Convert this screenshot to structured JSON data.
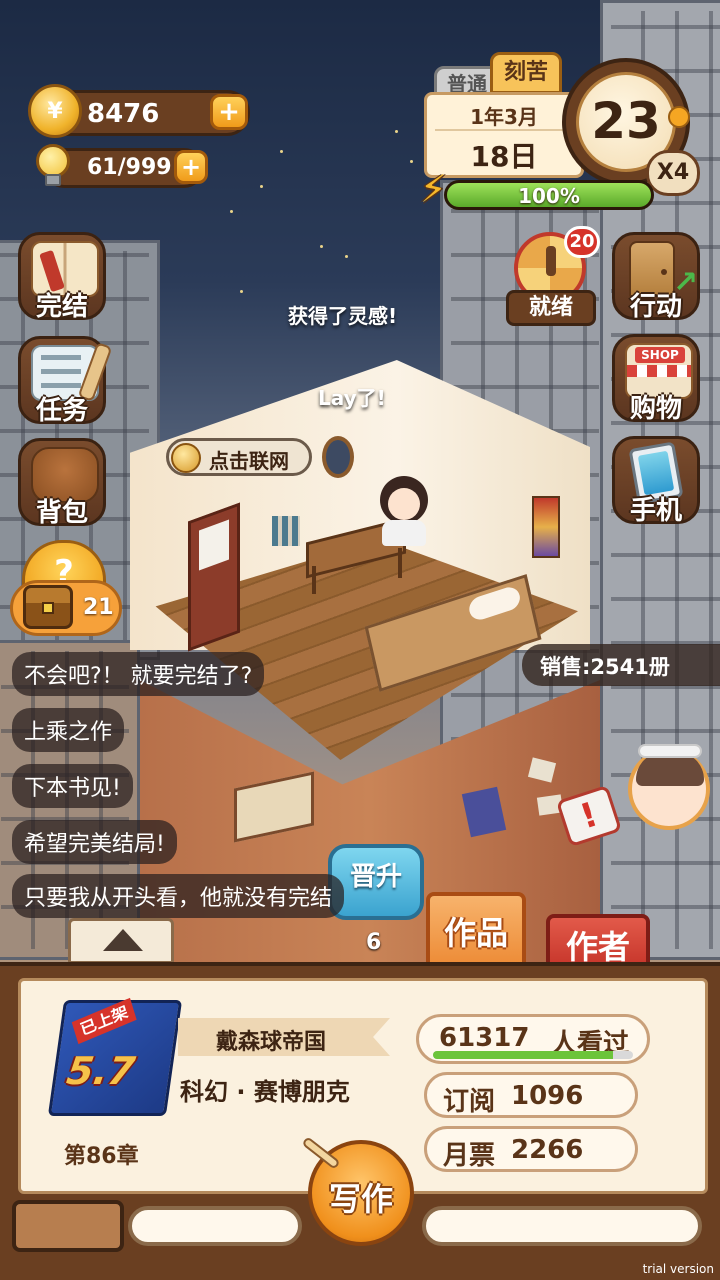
{
  "currency": {
    "coins": "8476",
    "inspiration": "61/999",
    "plus": "+"
  },
  "calendar": {
    "mode_normal": "普通",
    "mode_hard": "刻苦",
    "year_month": "1年3月",
    "day": "18日",
    "timer": "23",
    "speed": "X4",
    "energy_percent": "100%",
    "energy_fraction": 1.0
  },
  "left_menu": [
    {
      "label": "完结"
    },
    {
      "label": "任务"
    },
    {
      "label": "背包"
    }
  ],
  "treasure": {
    "count": "21"
  },
  "right_menu": {
    "ready": {
      "label": "就绪",
      "badge": "20"
    },
    "action": {
      "label": "行动"
    },
    "shop": {
      "label": "购物",
      "sign": "SHOP"
    },
    "phone": {
      "label": "手机"
    }
  },
  "room": {
    "float_text_1": "获得了灵感!",
    "float_text_2": "Lay了!",
    "connect_label": "点击联网",
    "sales": "销售:2541册",
    "promote_label": "晋升",
    "promote_count": "6"
  },
  "chat": [
    "不会吧?！ 就要完结了?",
    "上乘之作",
    "下本书见!",
    "希望完美结局!",
    "只要我从开头看，他就没有完结"
  ],
  "tabs": {
    "works": "作品",
    "author": "作者"
  },
  "book": {
    "status_tag": "已上架",
    "rating": "5.7",
    "title": "戴森球帝国",
    "genre": "科幻 · 赛博朋克",
    "chapter": "第86章",
    "views_num": "61317",
    "views_label": "人看过",
    "views_progress": 0.9,
    "subs_label": "订阅",
    "subs_num": "1096",
    "tickets_label": "月票",
    "tickets_num": "2266"
  },
  "write_button": "写作",
  "watermark": "trial version",
  "colors": {
    "accent_orange": "#f29a1c",
    "wood_dark": "#6a3f21",
    "paper": "#fbf1df",
    "green_bar": "#6cc43a",
    "author_red": "#d8453c"
  }
}
